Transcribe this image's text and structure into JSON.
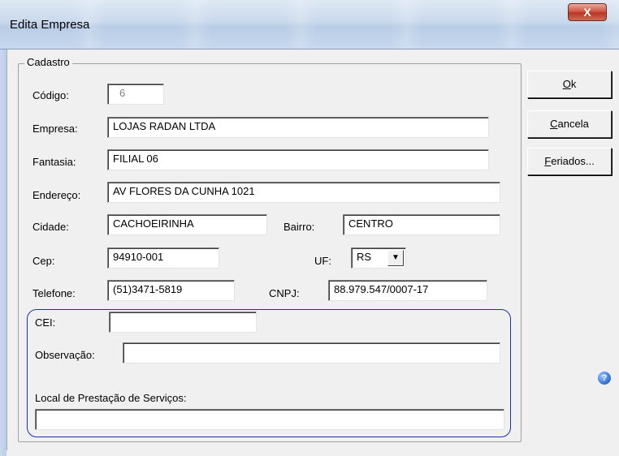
{
  "window": {
    "title": "Edita Empresa",
    "close_label": "X"
  },
  "group": {
    "legend": "Cadastro"
  },
  "form": {
    "codigo_label": "Código:",
    "codigo_value": "6",
    "empresa_label": "Empresa:",
    "empresa_value": "LOJAS RADAN LTDA",
    "fantasia_label": "Fantasia:",
    "fantasia_value": "FILIAL 06",
    "endereco_label": "Endereço:",
    "endereco_value": "AV FLORES DA CUNHA  1021",
    "cidade_label": "Cidade:",
    "cidade_value": "CACHOEIRINHA",
    "bairro_label": "Bairro:",
    "bairro_value": "CENTRO",
    "cep_label": "Cep:",
    "cep_value": "94910-001",
    "uf_label": "UF:",
    "uf_value": "RS",
    "telefone_label": "Telefone:",
    "telefone_value": "(51)3471-5819",
    "cnpj_label": "CNPJ:",
    "cnpj_value": "88.979.547/0007-17",
    "cei_label": "CEI:",
    "cei_value": "",
    "observacao_label": "Observação:",
    "observacao_value": "",
    "local_label": "Local de Prestação de Serviços:",
    "local_value": ""
  },
  "buttons": {
    "ok_accel": "O",
    "ok_rest": "k",
    "cancela_accel": "C",
    "cancela_rest": "ancela",
    "feriados_accel": "F",
    "feriados_rest": "eriados..."
  },
  "help": {
    "icon": "help-icon",
    "glyph": "?"
  },
  "colors": {
    "panel_border": "#1b2fbf",
    "close_button": "#c8412e"
  }
}
